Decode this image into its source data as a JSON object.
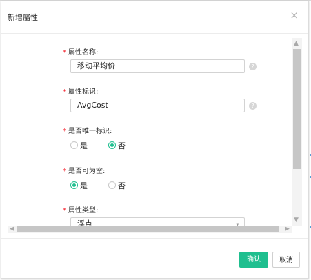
{
  "dialog": {
    "title": "新增屬性",
    "close_icon": "×"
  },
  "form": {
    "required_mark": "*",
    "fields": {
      "name": {
        "label": "屬性名称:",
        "value": "移动平均价",
        "help": "?"
      },
      "identifier": {
        "label": "属性标识:",
        "value": "AvgCost",
        "help": "?"
      },
      "unique": {
        "label": "是否唯一标识:",
        "options": [
          "是",
          "否"
        ],
        "selected": "否"
      },
      "nullable": {
        "label": "是否可为空:",
        "options": [
          "是",
          "否"
        ],
        "selected": "是"
      },
      "type": {
        "label": "属性类型:",
        "value": "浮点",
        "arrow": "▾"
      }
    }
  },
  "scrollbar": {
    "up": "▲",
    "down": "▼",
    "left": "◀",
    "right": "▶"
  },
  "footer": {
    "ok_label": "确认",
    "cancel_label": "取消"
  },
  "colors": {
    "accent": "#1fbf8f",
    "required": "#f5222d"
  }
}
